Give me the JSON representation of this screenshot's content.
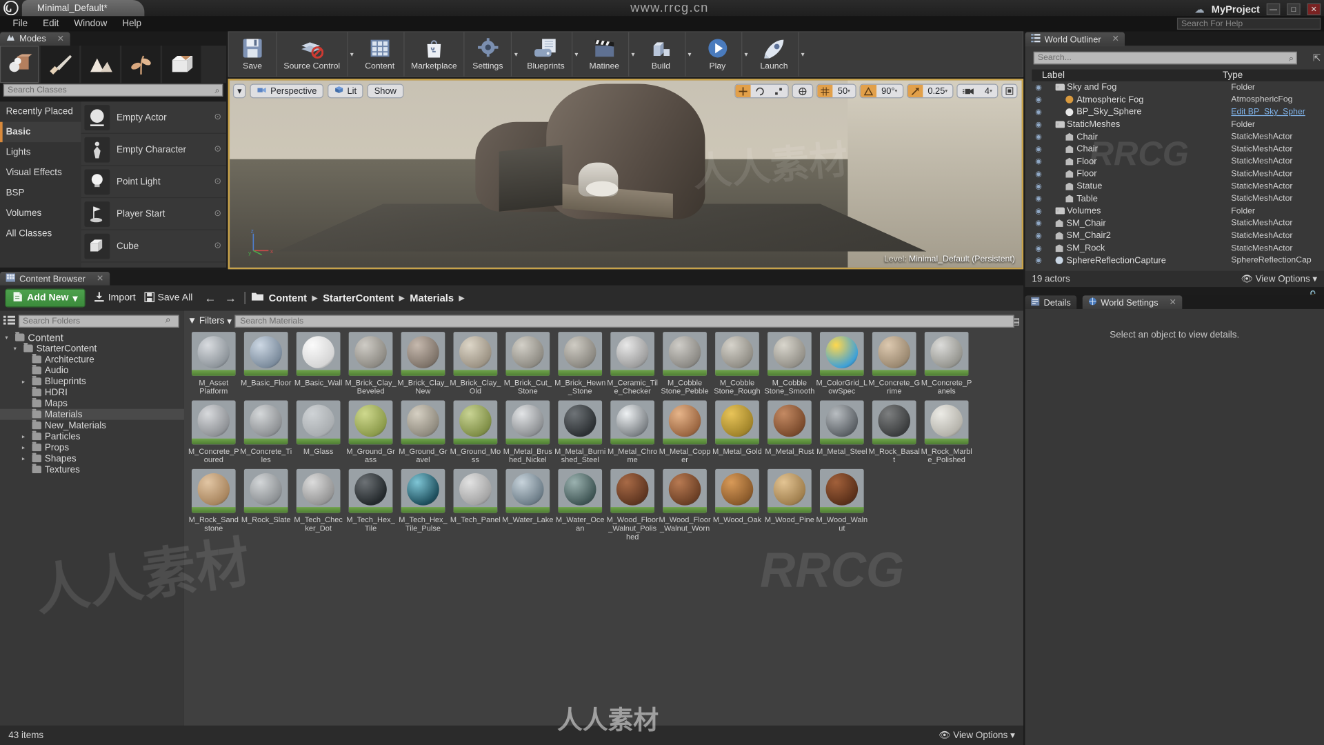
{
  "titlebar": {
    "tab_label": "Minimal_Default*",
    "center_text": "www.rrcg.cn",
    "project_name": "MyProject",
    "help_placeholder": "Search For Help",
    "min": "—",
    "max": "□",
    "close": "✕"
  },
  "menubar": {
    "items": [
      "File",
      "Edit",
      "Window",
      "Help"
    ]
  },
  "modes": {
    "tab_label": "Modes",
    "search_placeholder": "Search Classes",
    "mode_buttons": [
      "place-mode-icon",
      "paint-mode-icon",
      "landscape-mode-icon",
      "foliage-mode-icon",
      "geometry-mode-icon"
    ],
    "categories": [
      "Recently Placed",
      "Basic",
      "Lights",
      "Visual Effects",
      "BSP",
      "Volumes",
      "All Classes"
    ],
    "selected_category": "Basic",
    "placeables": [
      "Empty Actor",
      "Empty Character",
      "Point Light",
      "Player Start",
      "Cube"
    ]
  },
  "toolbar": {
    "items": [
      {
        "label": "Save",
        "icon": "save-icon",
        "caret": false
      },
      {
        "label": "Source Control",
        "icon": "source-control-icon",
        "caret": true
      },
      {
        "label": "Content",
        "icon": "content-icon",
        "caret": false
      },
      {
        "label": "Marketplace",
        "icon": "marketplace-icon",
        "caret": false
      },
      {
        "label": "Settings",
        "icon": "settings-gear-icon",
        "caret": true
      },
      {
        "label": "Blueprints",
        "icon": "blueprints-icon",
        "caret": true
      },
      {
        "label": "Matinee",
        "icon": "matinee-clapper-icon",
        "caret": true
      },
      {
        "label": "Build",
        "icon": "build-icon",
        "caret": true
      },
      {
        "label": "Play",
        "icon": "play-icon",
        "caret": true
      },
      {
        "label": "Launch",
        "icon": "launch-icon",
        "caret": true
      }
    ]
  },
  "viewport": {
    "view_mode_caret": "▾",
    "perspective_label": "Perspective",
    "lit_label": "Lit",
    "show_label": "Show",
    "grid_snap_value": "50",
    "rotation_snap_value": "90°",
    "scale_snap_value": "0.25",
    "camera_speed_value": "4",
    "level_prefix": "Level:",
    "level_name": "Minimal_Default (Persistent)",
    "axis_z": "z",
    "axis_y": "y",
    "axis_x": "x"
  },
  "content_browser": {
    "tab_label": "Content Browser",
    "add_new_label": "Add New",
    "import_label": "Import",
    "save_all_label": "Save All",
    "breadcrumbs": [
      "Content",
      "StarterContent",
      "Materials"
    ],
    "folder_search_placeholder": "Search Folders",
    "filters_label": "Filters",
    "asset_search_placeholder": "Search Materials",
    "item_count": "43 items",
    "view_options_label": "View Options",
    "folder_tree": [
      {
        "label": "Content",
        "depth": 0,
        "twisty": "▾",
        "selected": false
      },
      {
        "label": "StarterContent",
        "depth": 1,
        "twisty": "▾",
        "selected": false
      },
      {
        "label": "Architecture",
        "depth": 2,
        "twisty": "",
        "selected": false
      },
      {
        "label": "Audio",
        "depth": 2,
        "twisty": "",
        "selected": false
      },
      {
        "label": "Blueprints",
        "depth": 2,
        "twisty": "▸",
        "selected": false
      },
      {
        "label": "HDRI",
        "depth": 2,
        "twisty": "",
        "selected": false
      },
      {
        "label": "Maps",
        "depth": 2,
        "twisty": "",
        "selected": false
      },
      {
        "label": "Materials",
        "depth": 2,
        "twisty": "",
        "selected": true
      },
      {
        "label": "New_Materials",
        "depth": 2,
        "twisty": "",
        "selected": false
      },
      {
        "label": "Particles",
        "depth": 2,
        "twisty": "▸",
        "selected": false
      },
      {
        "label": "Props",
        "depth": 2,
        "twisty": "▸",
        "selected": false
      },
      {
        "label": "Shapes",
        "depth": 2,
        "twisty": "▸",
        "selected": false
      },
      {
        "label": "Textures",
        "depth": 2,
        "twisty": "",
        "selected": false
      }
    ],
    "assets": [
      {
        "name": "M_Asset Platform",
        "c1": "#d9dce0",
        "c2": "#8e959b"
      },
      {
        "name": "M_Basic_Floor",
        "c1": "#cdd8e4",
        "c2": "#7b8b9c"
      },
      {
        "name": "M_Basic_Wall",
        "c1": "#fbfbfb",
        "c2": "#d5d5d5"
      },
      {
        "name": "M_Brick_Clay_Beveled",
        "c1": "#cfccc6",
        "c2": "#8d8a83"
      },
      {
        "name": "M_Brick_Clay_New",
        "c1": "#c6b9ae",
        "c2": "#7d7268"
      },
      {
        "name": "M_Brick_Clay_Old",
        "c1": "#ddd6c8",
        "c2": "#9c9384"
      },
      {
        "name": "M_Brick_Cut_Stone",
        "c1": "#d3d0c8",
        "c2": "#8e8b83"
      },
      {
        "name": "M_Brick_Hewn_Stone",
        "c1": "#cfccc4",
        "c2": "#8a8780"
      },
      {
        "name": "M_Ceramic_Tile_Checker",
        "c1": "#e8e8e8",
        "c2": "#9d9d9d"
      },
      {
        "name": "M_Cobble Stone_Pebble",
        "c1": "#cfcdc8",
        "c2": "#8b8984"
      },
      {
        "name": "M_Cobble Stone_Rough",
        "c1": "#d6d3cb",
        "c2": "#918e86"
      },
      {
        "name": "M_Cobble Stone_Smooth",
        "c1": "#d9d6cd",
        "c2": "#939088"
      },
      {
        "name": "M_ColorGrid_LowSpec",
        "c1": "#ffd84d",
        "c2": "#3da0d8"
      },
      {
        "name": "M_Concrete_Grime",
        "c1": "#ddc9b0",
        "c2": "#9a8870"
      },
      {
        "name": "M_Concrete_Panels",
        "c1": "#dcdcda",
        "c2": "#95958f"
      },
      {
        "name": "M_Concrete_Poured",
        "c1": "#d8dadd",
        "c2": "#8f9296"
      },
      {
        "name": "M_Concrete_Tiles",
        "c1": "#d5d8da",
        "c2": "#8e9194"
      },
      {
        "name": "M_Glass",
        "c1": "#cfd3d6",
        "c2": "#a9adb0"
      },
      {
        "name": "M_Ground_Grass",
        "c1": "#cfd98e",
        "c2": "#8b9a4a"
      },
      {
        "name": "M_Ground_Gravel",
        "c1": "#d6d0c3",
        "c2": "#8f8a7e"
      },
      {
        "name": "M_Ground_Moss",
        "c1": "#c9d494",
        "c2": "#7f8e46"
      },
      {
        "name": "M_Metal_Brushed_Nickel",
        "c1": "#e2e4e6",
        "c2": "#8d9093"
      },
      {
        "name": "M_Metal_Burnished_Steel",
        "c1": "#6f7478",
        "c2": "#2c3033"
      },
      {
        "name": "M_Metal_Chrome",
        "c1": "#eef1f3",
        "c2": "#7d8286"
      },
      {
        "name": "M_Metal_Copper",
        "c1": "#e7b58a",
        "c2": "#9a6540"
      },
      {
        "name": "M_Metal_Gold",
        "c1": "#e8c459",
        "c2": "#a1842a"
      },
      {
        "name": "M_Metal_Rust",
        "c1": "#c48a63",
        "c2": "#7a4a2c"
      },
      {
        "name": "M_Metal_Steel",
        "c1": "#b9bec2",
        "c2": "#5c6166"
      },
      {
        "name": "M_Rock_Basalt",
        "c1": "#7d7f80",
        "c2": "#3b3d3e"
      },
      {
        "name": "M_Rock_Marble_Polished",
        "c1": "#ecebe6",
        "c2": "#b5b3ab"
      },
      {
        "name": "M_Rock_Sandstone",
        "c1": "#e2c6a4",
        "c2": "#a8855e"
      },
      {
        "name": "M_Rock_Slate",
        "c1": "#d3d6d8",
        "c2": "#8c9093"
      },
      {
        "name": "M_Tech_Checker_Dot",
        "c1": "#dcdcdc",
        "c2": "#959595"
      },
      {
        "name": "M_Tech_Hex_Tile",
        "c1": "#6d7276",
        "c2": "#23282b"
      },
      {
        "name": "M_Tech_Hex_Tile_Pulse",
        "c1": "#7fc6d6",
        "c2": "#1d4e5c"
      },
      {
        "name": "M_Tech_Panel",
        "c1": "#e2e2e2",
        "c2": "#a4a4a4"
      },
      {
        "name": "M_Water_Lake",
        "c1": "#c7d3db",
        "c2": "#6d7d88"
      },
      {
        "name": "M_Water_Ocean",
        "c1": "#9bb2b0",
        "c2": "#3f5554"
      },
      {
        "name": "M_Wood_Floor_Walnut_Polished",
        "c1": "#a86a46",
        "c2": "#5e3520"
      },
      {
        "name": "M_Wood_Floor_Walnut_Worn",
        "c1": "#b87a52",
        "c2": "#6b3f25"
      },
      {
        "name": "M_Wood_Oak",
        "c1": "#d89a58",
        "c2": "#8a5a2b"
      },
      {
        "name": "M_Wood_Pine",
        "c1": "#e3c493",
        "c2": "#a07f4e"
      },
      {
        "name": "M_Wood_Walnut",
        "c1": "#a2603a",
        "c2": "#5a301a"
      }
    ]
  },
  "outliner": {
    "tab_label": "World Outliner",
    "search_placeholder": "Search...",
    "col_label": "Label",
    "col_type": "Type",
    "actor_count": "19 actors",
    "view_options_label": "View Options",
    "rows": [
      {
        "label": "Sky and Fog",
        "type": "Folder",
        "depth": 1,
        "icon": "folder-icon",
        "link": false
      },
      {
        "label": "Atmospheric Fog",
        "type": "AtmosphericFog",
        "depth": 2,
        "icon": "actor-icon",
        "link": false
      },
      {
        "label": "BP_Sky_Sphere",
        "type": "Edit BP_Sky_Spher",
        "depth": 2,
        "icon": "blueprint-icon",
        "link": true
      },
      {
        "label": "StaticMeshes",
        "type": "Folder",
        "depth": 1,
        "icon": "folder-icon",
        "link": false
      },
      {
        "label": "Chair",
        "type": "StaticMeshActor",
        "depth": 2,
        "icon": "mesh-icon",
        "link": false
      },
      {
        "label": "Chair",
        "type": "StaticMeshActor",
        "depth": 2,
        "icon": "mesh-icon",
        "link": false
      },
      {
        "label": "Floor",
        "type": "StaticMeshActor",
        "depth": 2,
        "icon": "mesh-icon",
        "link": false
      },
      {
        "label": "Floor",
        "type": "StaticMeshActor",
        "depth": 2,
        "icon": "mesh-icon",
        "link": false
      },
      {
        "label": "Statue",
        "type": "StaticMeshActor",
        "depth": 2,
        "icon": "mesh-icon",
        "link": false
      },
      {
        "label": "Table",
        "type": "StaticMeshActor",
        "depth": 2,
        "icon": "mesh-icon",
        "link": false
      },
      {
        "label": "Volumes",
        "type": "Folder",
        "depth": 1,
        "icon": "folder-icon",
        "link": false
      },
      {
        "label": "SM_Chair",
        "type": "StaticMeshActor",
        "depth": 1,
        "icon": "mesh-icon",
        "link": false
      },
      {
        "label": "SM_Chair2",
        "type": "StaticMeshActor",
        "depth": 1,
        "icon": "mesh-icon",
        "link": false
      },
      {
        "label": "SM_Rock",
        "type": "StaticMeshActor",
        "depth": 1,
        "icon": "mesh-icon",
        "link": false
      },
      {
        "label": "SphereReflectionCapture",
        "type": "SphereReflectionCap",
        "depth": 1,
        "icon": "sphere-icon",
        "link": false
      }
    ]
  },
  "details": {
    "tab_label": "Details",
    "world_settings_tab_label": "World Settings",
    "empty_message": "Select an object to view details."
  },
  "watermarks": [
    "人人素材",
    "RRCG",
    "人人素材",
    "RRCG",
    "人人素材"
  ]
}
